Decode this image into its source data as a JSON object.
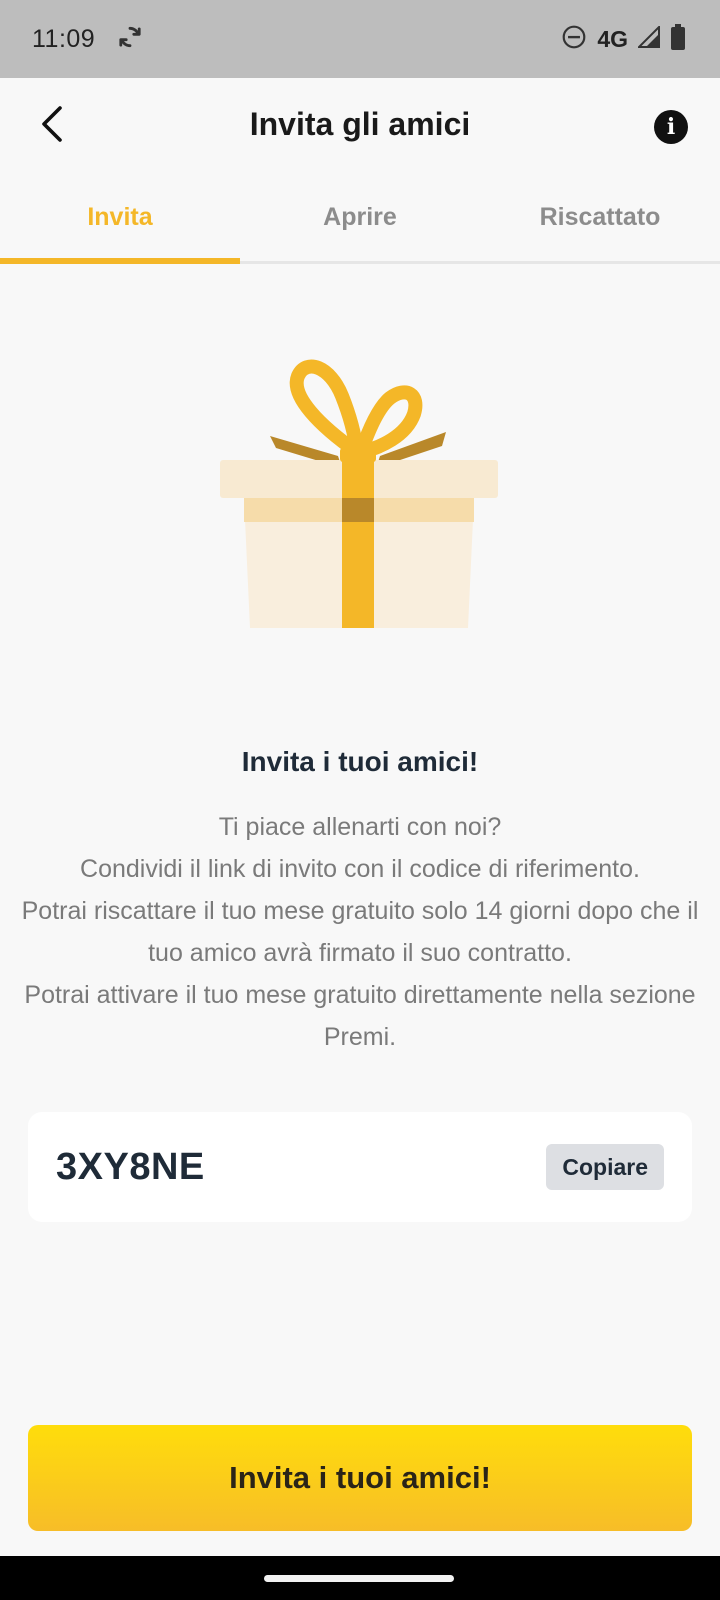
{
  "status_bar": {
    "time": "11:09",
    "network": "4G",
    "icons": [
      "sync-icon",
      "do-not-disturb-icon",
      "signal-icon",
      "battery-icon"
    ]
  },
  "header": {
    "title": "Invita gli amici",
    "back_icon": "chevron-left-icon",
    "info_icon": "info-icon",
    "info_glyph": "i"
  },
  "tabs": [
    {
      "label": "Invita",
      "active": true
    },
    {
      "label": "Aprire",
      "active": false
    },
    {
      "label": "Riscattato",
      "active": false
    }
  ],
  "illustration": {
    "icon": "gift-icon"
  },
  "invite": {
    "heading": "Invita i tuoi amici!",
    "body": "Ti piace allenarti con noi?\nCondividi il link di invito con il codice di riferimento.\nPotrai riscattare il tuo mese gratuito solo 14 giorni dopo che il tuo amico avrà firmato il suo contratto.\nPotrai attivare il tuo mese gratuito direttamente nella sezione Premi."
  },
  "referral": {
    "code": "3XY8NE",
    "copy_label": "Copiare"
  },
  "cta": {
    "label": "Invita i tuoi amici!"
  },
  "colors": {
    "accent": "#f4b728",
    "cta_top": "#ffdd0b",
    "cta_bottom": "#f7bd28",
    "status_bar": "#bdbdbd"
  }
}
